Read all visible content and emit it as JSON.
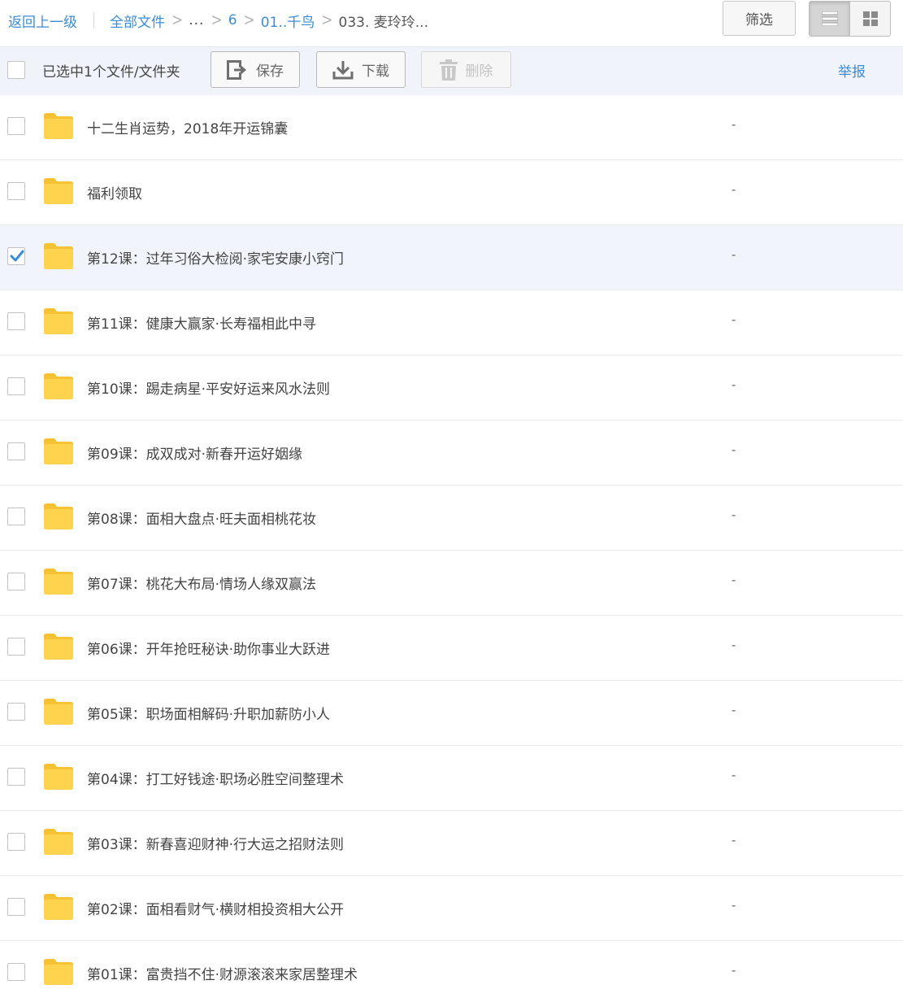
{
  "breadcrumb": {
    "back_label": "返回上一级",
    "all_files_label": "全部文件",
    "ellipsis": "...",
    "items": [
      "6",
      "01..千鸟"
    ],
    "current": "033. 麦玲玲..."
  },
  "header": {
    "filter_label": "筛选",
    "view_mode": "list"
  },
  "toolbar": {
    "selected_text": "已选中1个文件/文件夹",
    "save_label": "保存",
    "download_label": "下载",
    "delete_label": "删除",
    "report_label": "举报"
  },
  "colors": {
    "link": "#3b8cd6",
    "folder": "#ffd34e",
    "checkmark": "#3b8cd6",
    "selected_row": "#f1f5fb"
  },
  "files": [
    {
      "name": "十二生肖运势，2018年开运锦囊",
      "size": "-",
      "type": "folder",
      "checked": false
    },
    {
      "name": "福利领取",
      "size": "-",
      "type": "folder",
      "checked": false
    },
    {
      "name": "第12课：过年习俗大检阅·家宅安康小窍门",
      "size": "-",
      "type": "folder",
      "checked": true
    },
    {
      "name": "第11课：健康大赢家·长寿福相此中寻",
      "size": "-",
      "type": "folder",
      "checked": false
    },
    {
      "name": "第10课：踢走病星·平安好运来风水法则",
      "size": "-",
      "type": "folder",
      "checked": false
    },
    {
      "name": "第09课：成双成对·新春开运好姻缘",
      "size": "-",
      "type": "folder",
      "checked": false
    },
    {
      "name": "第08课：面相大盘点·旺夫面相桃花妆",
      "size": "-",
      "type": "folder",
      "checked": false
    },
    {
      "name": "第07课：桃花大布局·情场人缘双赢法",
      "size": "-",
      "type": "folder",
      "checked": false
    },
    {
      "name": "第06课：开年抢旺秘诀·助你事业大跃进",
      "size": "-",
      "type": "folder",
      "checked": false
    },
    {
      "name": "第05课：职场面相解码·升职加薪防小人",
      "size": "-",
      "type": "folder",
      "checked": false
    },
    {
      "name": "第04课：打工好钱途·职场必胜空间整理术",
      "size": "-",
      "type": "folder",
      "checked": false
    },
    {
      "name": "第03课：新春喜迎财神·行大运之招财法则",
      "size": "-",
      "type": "folder",
      "checked": false
    },
    {
      "name": "第02课：面相看财气·横财相投资相大公开",
      "size": "-",
      "type": "folder",
      "checked": false
    },
    {
      "name": "第01课：富贵挡不住·财源滚滚来家居整理术",
      "size": "-",
      "type": "folder",
      "checked": false
    }
  ]
}
